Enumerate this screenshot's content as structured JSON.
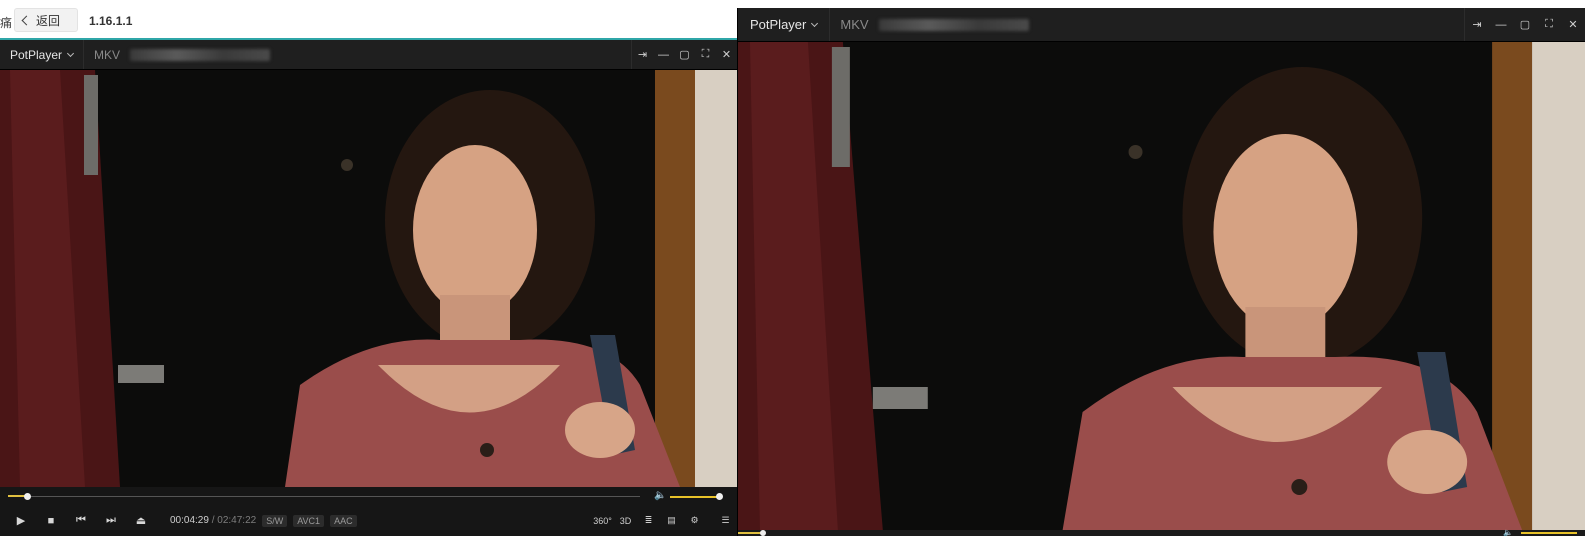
{
  "browser": {
    "edge_glyph": "痛",
    "back_label": "返回",
    "version": "1.16.1.1"
  },
  "player_left": {
    "app_name": "PotPlayer",
    "format": "MKV",
    "window_buttons": [
      "⇥",
      "—",
      "▢",
      "⛶",
      "✕"
    ],
    "time_current": "00:04:29",
    "time_sep": "/",
    "time_total": "02:47:22",
    "badges": [
      "S/W",
      "AVC1",
      "AAC"
    ],
    "right_controls": {
      "vr": "360°",
      "three_d": "3D",
      "subtitle": "≣",
      "playlist": "▤",
      "settings": "⚙",
      "menu": "☰"
    },
    "progress": {
      "position_fraction": 0.03,
      "volume_fraction": 0.95
    }
  },
  "player_right": {
    "app_name": "PotPlayer",
    "format": "MKV",
    "window_buttons": [
      "⇥",
      "—",
      "▢",
      "⛶",
      "✕"
    ],
    "progress": {
      "position_fraction": 0.03
    }
  },
  "colors": {
    "accent": "#e0c040",
    "volume": "#e8c229",
    "teal_line": "#2fa6a8",
    "chrome_dark": "#1f1f1f"
  }
}
